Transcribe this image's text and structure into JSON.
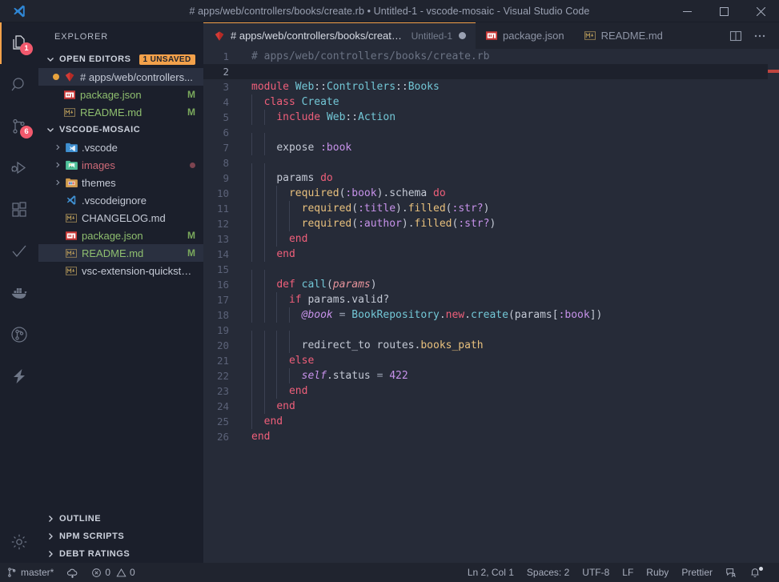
{
  "titlebar": {
    "logo_icon": "vscode-logo-icon",
    "dirty_indicator": "●",
    "title": "# apps/web/controllers/books/create.rb • Untitled-1 - vscode-mosaic - Visual Studio Code",
    "minimize_label": "Minimize",
    "maximize_label": "Maximize",
    "close_label": "Close"
  },
  "activitybar": {
    "items": [
      {
        "name": "explorer",
        "icon": "files-icon",
        "badge": "1",
        "active": true
      },
      {
        "name": "search",
        "icon": "search-icon",
        "badge": "",
        "active": false
      },
      {
        "name": "source-control",
        "icon": "source-control-icon",
        "badge": "6",
        "active": false
      },
      {
        "name": "run-and-debug",
        "icon": "run-debug-icon",
        "badge": "",
        "active": false
      },
      {
        "name": "extensions",
        "icon": "extensions-icon",
        "badge": "",
        "active": false
      },
      {
        "name": "testing",
        "icon": "check-icon",
        "badge": "",
        "active": false
      },
      {
        "name": "docker",
        "icon": "docker-whale-icon",
        "badge": "",
        "active": false
      },
      {
        "name": "git-graph",
        "icon": "git-graph-icon",
        "badge": "",
        "active": false
      },
      {
        "name": "thunder-client",
        "icon": "lightning-bolt-icon",
        "badge": "",
        "active": false
      }
    ],
    "bottom": [
      {
        "name": "manage",
        "icon": "gear-icon"
      }
    ]
  },
  "sidebar": {
    "title": "EXPLORER",
    "open_editors": {
      "label": "OPEN EDITORS",
      "badge": "1 UNSAVED",
      "chevron": "chevron-down-icon",
      "items": [
        {
          "label": "# apps/web/controllers...",
          "icon": "ruby-icon",
          "dirty": true,
          "mark": "",
          "selected": true,
          "color": "grey"
        },
        {
          "label": "package.json",
          "icon": "npm-icon",
          "dirty": false,
          "mark": "M",
          "selected": false,
          "color": "green"
        },
        {
          "label": "README.md",
          "icon": "markdown-icon",
          "dirty": false,
          "mark": "M",
          "selected": false,
          "color": "green"
        }
      ]
    },
    "workspace": {
      "label": "VSCODE-MOSAIC",
      "chevron": "chevron-down-icon",
      "items": [
        {
          "label": ".vscode",
          "icon": "folder-vscode-icon",
          "twisty": "chevron-right-icon",
          "mark": "",
          "color": "grey",
          "dot": false,
          "selected": false
        },
        {
          "label": "images",
          "icon": "folder-images-icon",
          "twisty": "chevron-right-icon",
          "mark": "",
          "color": "red",
          "dot": true,
          "selected": false
        },
        {
          "label": "themes",
          "icon": "folder-themes-icon",
          "twisty": "chevron-right-icon",
          "mark": "",
          "color": "grey",
          "dot": false,
          "selected": false
        },
        {
          "label": ".vscodeignore",
          "icon": "vscode-file-icon",
          "twisty": "",
          "mark": "",
          "color": "grey",
          "dot": false,
          "selected": false
        },
        {
          "label": "CHANGELOG.md",
          "icon": "markdown-icon",
          "twisty": "",
          "mark": "",
          "color": "grey",
          "dot": false,
          "selected": false
        },
        {
          "label": "package.json",
          "icon": "npm-icon",
          "twisty": "",
          "mark": "M",
          "color": "green",
          "dot": false,
          "selected": false
        },
        {
          "label": "README.md",
          "icon": "markdown-icon",
          "twisty": "",
          "mark": "M",
          "color": "green",
          "dot": false,
          "selected": true
        },
        {
          "label": "vsc-extension-quickstar...",
          "icon": "markdown-icon",
          "twisty": "",
          "mark": "",
          "color": "grey",
          "dot": false,
          "selected": false
        }
      ]
    },
    "bottom_sections": [
      {
        "label": "OUTLINE",
        "chevron": "chevron-right-icon"
      },
      {
        "label": "NPM SCRIPTS",
        "chevron": "chevron-right-icon"
      },
      {
        "label": "DEBT RATINGS",
        "chevron": "chevron-right-icon"
      }
    ]
  },
  "tabs": [
    {
      "name": "create.rb",
      "label": "# apps/web/controllers/books/create.rb",
      "description": "Untitled-1",
      "icon": "ruby-icon",
      "dirty": true,
      "active": true
    },
    {
      "name": "package.json",
      "label": "package.json",
      "description": "",
      "icon": "npm-icon",
      "dirty": false,
      "active": false
    },
    {
      "name": "README.md",
      "label": "README.md",
      "description": "",
      "icon": "markdown-icon",
      "dirty": false,
      "active": false
    }
  ],
  "tab_actions": [
    {
      "name": "split-editor",
      "icon": "split-editor-icon"
    },
    {
      "name": "more-actions",
      "icon": "ellipsis-icon"
    }
  ],
  "editor": {
    "language": "ruby",
    "active_line": 2,
    "overview_marks": [
      {
        "line": 2,
        "color": "#c0453f"
      }
    ],
    "lines": [
      {
        "n": 1,
        "indent": 0,
        "tokens": [
          {
            "t": "# apps/web/controllers/books/create.rb",
            "c": "t-comment"
          }
        ]
      },
      {
        "n": 2,
        "indent": 0,
        "tokens": []
      },
      {
        "n": 3,
        "indent": 0,
        "tokens": [
          {
            "t": "module",
            "c": "t-kw"
          },
          {
            "t": " ",
            "c": "t-plain"
          },
          {
            "t": "Web",
            "c": "t-class"
          },
          {
            "t": "::",
            "c": "t-plain"
          },
          {
            "t": "Controllers",
            "c": "t-class"
          },
          {
            "t": "::",
            "c": "t-plain"
          },
          {
            "t": "Books",
            "c": "t-class"
          }
        ]
      },
      {
        "n": 4,
        "indent": 1,
        "tokens": [
          {
            "t": "  ",
            "c": "t-plain"
          },
          {
            "t": "class",
            "c": "t-kw"
          },
          {
            "t": " ",
            "c": "t-plain"
          },
          {
            "t": "Create",
            "c": "t-class"
          }
        ]
      },
      {
        "n": 5,
        "indent": 2,
        "tokens": [
          {
            "t": "    ",
            "c": "t-plain"
          },
          {
            "t": "include",
            "c": "t-kw"
          },
          {
            "t": " ",
            "c": "t-plain"
          },
          {
            "t": "Web",
            "c": "t-class"
          },
          {
            "t": "::",
            "c": "t-plain"
          },
          {
            "t": "Action",
            "c": "t-class"
          }
        ]
      },
      {
        "n": 6,
        "indent": 2,
        "tokens": []
      },
      {
        "n": 7,
        "indent": 2,
        "tokens": [
          {
            "t": "    ",
            "c": "t-plain"
          },
          {
            "t": "expose",
            "c": "t-plain"
          },
          {
            "t": " ",
            "c": "t-plain"
          },
          {
            "t": ":book",
            "c": "t-sym"
          }
        ]
      },
      {
        "n": 8,
        "indent": 2,
        "tokens": []
      },
      {
        "n": 9,
        "indent": 2,
        "tokens": [
          {
            "t": "    ",
            "c": "t-plain"
          },
          {
            "t": "params",
            "c": "t-plain"
          },
          {
            "t": " ",
            "c": "t-plain"
          },
          {
            "t": "do",
            "c": "t-kw"
          }
        ]
      },
      {
        "n": 10,
        "indent": 3,
        "tokens": [
          {
            "t": "      ",
            "c": "t-plain"
          },
          {
            "t": "required",
            "c": "t-method"
          },
          {
            "t": "(",
            "c": "t-plain"
          },
          {
            "t": ":book",
            "c": "t-sym"
          },
          {
            "t": ").",
            "c": "t-plain"
          },
          {
            "t": "schema",
            "c": "t-plain"
          },
          {
            "t": " ",
            "c": "t-plain"
          },
          {
            "t": "do",
            "c": "t-kw"
          }
        ]
      },
      {
        "n": 11,
        "indent": 4,
        "tokens": [
          {
            "t": "        ",
            "c": "t-plain"
          },
          {
            "t": "required",
            "c": "t-method"
          },
          {
            "t": "(",
            "c": "t-plain"
          },
          {
            "t": ":title",
            "c": "t-sym"
          },
          {
            "t": ").",
            "c": "t-plain"
          },
          {
            "t": "filled",
            "c": "t-method"
          },
          {
            "t": "(",
            "c": "t-plain"
          },
          {
            "t": ":str?",
            "c": "t-sym"
          },
          {
            "t": ")",
            "c": "t-plain"
          }
        ]
      },
      {
        "n": 12,
        "indent": 4,
        "tokens": [
          {
            "t": "        ",
            "c": "t-plain"
          },
          {
            "t": "required",
            "c": "t-method"
          },
          {
            "t": "(",
            "c": "t-plain"
          },
          {
            "t": ":author",
            "c": "t-sym"
          },
          {
            "t": ").",
            "c": "t-plain"
          },
          {
            "t": "filled",
            "c": "t-method"
          },
          {
            "t": "(",
            "c": "t-plain"
          },
          {
            "t": ":str?",
            "c": "t-sym"
          },
          {
            "t": ")",
            "c": "t-plain"
          }
        ]
      },
      {
        "n": 13,
        "indent": 3,
        "tokens": [
          {
            "t": "      ",
            "c": "t-plain"
          },
          {
            "t": "end",
            "c": "t-kw"
          }
        ]
      },
      {
        "n": 14,
        "indent": 2,
        "tokens": [
          {
            "t": "    ",
            "c": "t-plain"
          },
          {
            "t": "end",
            "c": "t-kw"
          }
        ]
      },
      {
        "n": 15,
        "indent": 2,
        "tokens": []
      },
      {
        "n": 16,
        "indent": 2,
        "tokens": [
          {
            "t": "    ",
            "c": "t-plain"
          },
          {
            "t": "def",
            "c": "t-kw"
          },
          {
            "t": " ",
            "c": "t-plain"
          },
          {
            "t": "call",
            "c": "t-func"
          },
          {
            "t": "(",
            "c": "t-plain"
          },
          {
            "t": "params",
            "c": "t-param"
          },
          {
            "t": ")",
            "c": "t-plain"
          }
        ]
      },
      {
        "n": 17,
        "indent": 3,
        "tokens": [
          {
            "t": "      ",
            "c": "t-plain"
          },
          {
            "t": "if",
            "c": "t-kw"
          },
          {
            "t": " params.valid?",
            "c": "t-plain"
          }
        ]
      },
      {
        "n": 18,
        "indent": 4,
        "tokens": [
          {
            "t": "        ",
            "c": "t-plain"
          },
          {
            "t": "@book",
            "c": "t-var"
          },
          {
            "t": " ",
            "c": "t-plain"
          },
          {
            "t": "=",
            "c": "t-op"
          },
          {
            "t": " ",
            "c": "t-plain"
          },
          {
            "t": "BookRepository",
            "c": "t-class"
          },
          {
            "t": ".",
            "c": "t-plain"
          },
          {
            "t": "new",
            "c": "t-kw"
          },
          {
            "t": ".",
            "c": "t-plain"
          },
          {
            "t": "create",
            "c": "t-func"
          },
          {
            "t": "(params[",
            "c": "t-plain"
          },
          {
            "t": ":book",
            "c": "t-sym"
          },
          {
            "t": "])",
            "c": "t-plain"
          }
        ]
      },
      {
        "n": 19,
        "indent": 4,
        "tokens": []
      },
      {
        "n": 20,
        "indent": 4,
        "tokens": [
          {
            "t": "        ",
            "c": "t-plain"
          },
          {
            "t": "redirect_to routes.",
            "c": "t-plain"
          },
          {
            "t": "books_path",
            "c": "t-prop"
          }
        ]
      },
      {
        "n": 21,
        "indent": 3,
        "tokens": [
          {
            "t": "      ",
            "c": "t-plain"
          },
          {
            "t": "else",
            "c": "t-kw"
          }
        ]
      },
      {
        "n": 22,
        "indent": 4,
        "tokens": [
          {
            "t": "        ",
            "c": "t-plain"
          },
          {
            "t": "self",
            "c": "t-var"
          },
          {
            "t": ".status ",
            "c": "t-plain"
          },
          {
            "t": "=",
            "c": "t-op"
          },
          {
            "t": " ",
            "c": "t-plain"
          },
          {
            "t": "422",
            "c": "t-num"
          }
        ]
      },
      {
        "n": 23,
        "indent": 3,
        "tokens": [
          {
            "t": "      ",
            "c": "t-plain"
          },
          {
            "t": "end",
            "c": "t-kw"
          }
        ]
      },
      {
        "n": 24,
        "indent": 2,
        "tokens": [
          {
            "t": "    ",
            "c": "t-plain"
          },
          {
            "t": "end",
            "c": "t-kw"
          }
        ]
      },
      {
        "n": 25,
        "indent": 1,
        "tokens": [
          {
            "t": "  ",
            "c": "t-plain"
          },
          {
            "t": "end",
            "c": "t-kw"
          }
        ]
      },
      {
        "n": 26,
        "indent": 0,
        "tokens": [
          {
            "t": "end",
            "c": "t-kw"
          }
        ]
      }
    ]
  },
  "statusbar": {
    "left": [
      {
        "name": "branch",
        "icon": "source-control-icon",
        "label": "master*"
      },
      {
        "name": "sync",
        "icon": "cloud-sync-icon",
        "label": ""
      },
      {
        "name": "problems",
        "icon": "error-warning-icon",
        "label": "0 0",
        "errors": "0",
        "warnings": "0"
      }
    ],
    "right": [
      {
        "name": "cursor-position",
        "icon": "",
        "label": "Ln 2, Col 1"
      },
      {
        "name": "indentation",
        "icon": "",
        "label": "Spaces: 2"
      },
      {
        "name": "encoding",
        "icon": "",
        "label": "UTF-8"
      },
      {
        "name": "eol",
        "icon": "",
        "label": "LF"
      },
      {
        "name": "language-mode",
        "icon": "",
        "label": "Ruby"
      },
      {
        "name": "formatter",
        "icon": "",
        "label": "Prettier"
      },
      {
        "name": "feedback",
        "icon": "feedback-icon",
        "label": ""
      },
      {
        "name": "notifications",
        "icon": "bell-dot-icon",
        "label": ""
      }
    ]
  },
  "colors": {
    "accent": "#f3a14a",
    "badge_bg": "#f2596d",
    "editor_bg": "#262b38",
    "sidebar_bg": "#1b1f2b",
    "titlebar_bg": "#20242f",
    "error_mark": "#c0453f"
  }
}
